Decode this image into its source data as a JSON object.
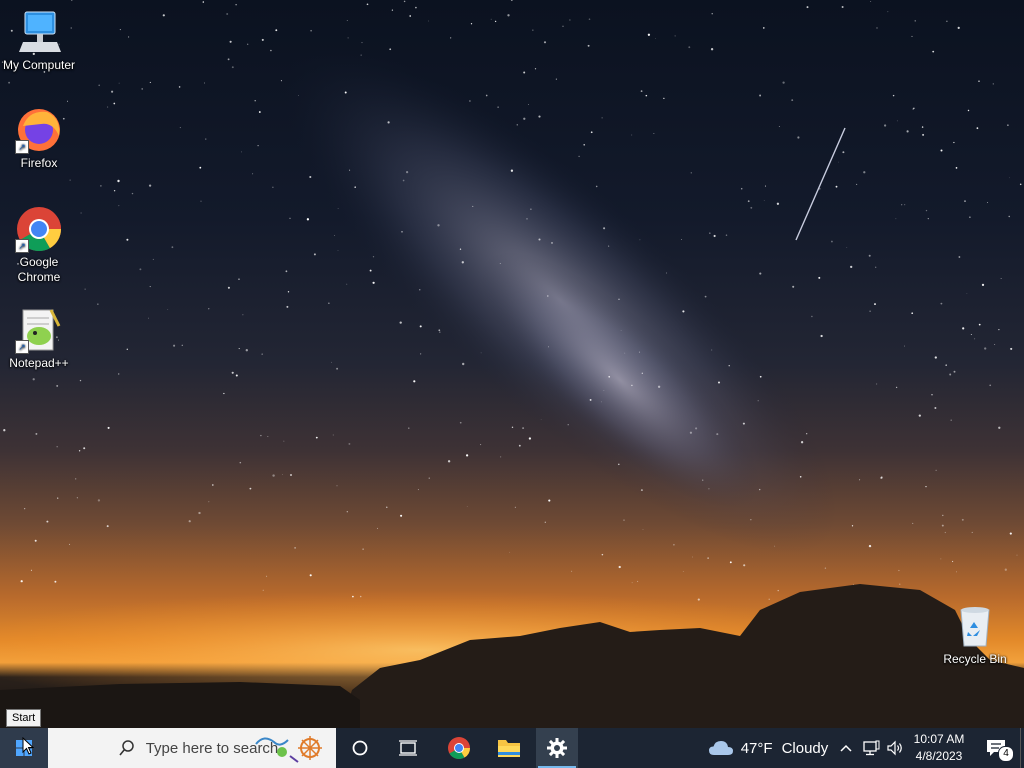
{
  "desktop": {
    "icons": [
      {
        "label": "My Computer"
      },
      {
        "label": "Firefox"
      },
      {
        "label": "Google Chrome"
      },
      {
        "label": "Notepad++"
      },
      {
        "label": "Recycle Bin"
      }
    ]
  },
  "tooltip": {
    "text": "Start"
  },
  "taskbar": {
    "search_placeholder": "Type here to search",
    "weather": {
      "temp": "47°F",
      "condition": "Cloudy"
    },
    "clock": {
      "time": "10:07 AM",
      "date": "4/8/2023"
    },
    "notifications_count": "4",
    "accent_color": "#76b9ed",
    "taskbar_color": "#1c2533"
  }
}
